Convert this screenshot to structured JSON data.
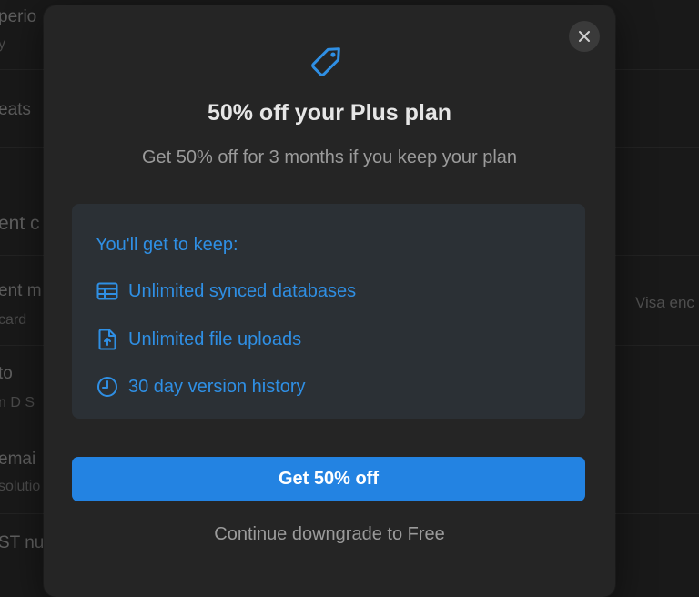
{
  "background": {
    "rows": [
      {
        "label": "perio",
        "sub": "y"
      },
      {
        "label": "eats",
        "sub": ""
      },
      {
        "label": "ent c",
        "sub": ""
      },
      {
        "label": "ent m",
        "sub": "card"
      },
      {
        "label": "to",
        "sub": "n D S"
      },
      {
        "label": "emai",
        "sub": "solutio"
      },
      {
        "label": "ST nu",
        "sub": ""
      }
    ],
    "right_text": "Visa enc"
  },
  "modal": {
    "icon": "tag-icon",
    "title": "50% off your Plus plan",
    "subtitle": "Get 50% off for 3 months if you keep your plan",
    "keep_heading": "You'll get to keep:",
    "features": [
      {
        "icon": "table-icon",
        "label": "Unlimited synced databases"
      },
      {
        "icon": "file-upload-icon",
        "label": "Unlimited file uploads"
      },
      {
        "icon": "clock-icon",
        "label": "30 day version history"
      }
    ],
    "primary_button": "Get 50% off",
    "secondary_link": "Continue downgrade to Free",
    "close_label": "✕"
  },
  "colors": {
    "accent": "#2383e2",
    "accent_text": "#2f8fe4",
    "modal_bg": "#252525",
    "keep_box_bg": "#2b3035"
  }
}
